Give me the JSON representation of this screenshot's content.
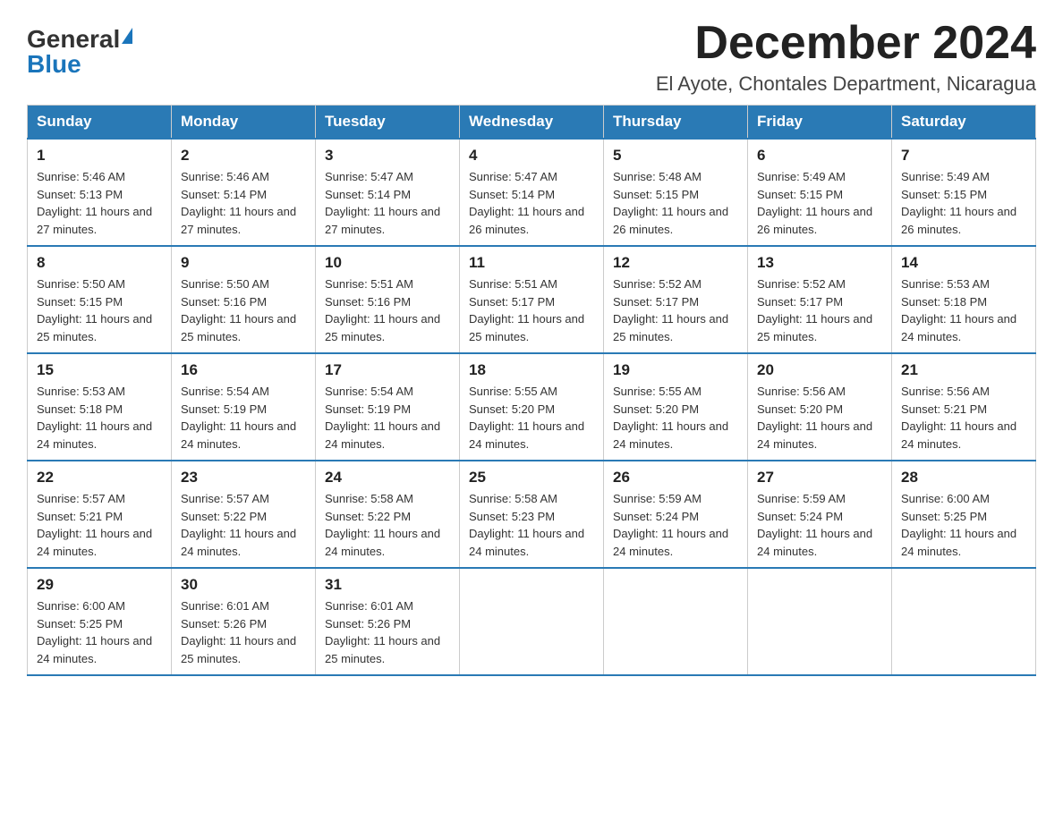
{
  "header": {
    "logo_general": "General",
    "logo_blue": "Blue",
    "month_title": "December 2024",
    "location": "El Ayote, Chontales Department, Nicaragua"
  },
  "weekdays": [
    "Sunday",
    "Monday",
    "Tuesday",
    "Wednesday",
    "Thursday",
    "Friday",
    "Saturday"
  ],
  "weeks": [
    [
      {
        "day": "1",
        "sunrise": "5:46 AM",
        "sunset": "5:13 PM",
        "daylight": "11 hours and 27 minutes."
      },
      {
        "day": "2",
        "sunrise": "5:46 AM",
        "sunset": "5:14 PM",
        "daylight": "11 hours and 27 minutes."
      },
      {
        "day": "3",
        "sunrise": "5:47 AM",
        "sunset": "5:14 PM",
        "daylight": "11 hours and 27 minutes."
      },
      {
        "day": "4",
        "sunrise": "5:47 AM",
        "sunset": "5:14 PM",
        "daylight": "11 hours and 26 minutes."
      },
      {
        "day": "5",
        "sunrise": "5:48 AM",
        "sunset": "5:15 PM",
        "daylight": "11 hours and 26 minutes."
      },
      {
        "day": "6",
        "sunrise": "5:49 AM",
        "sunset": "5:15 PM",
        "daylight": "11 hours and 26 minutes."
      },
      {
        "day": "7",
        "sunrise": "5:49 AM",
        "sunset": "5:15 PM",
        "daylight": "11 hours and 26 minutes."
      }
    ],
    [
      {
        "day": "8",
        "sunrise": "5:50 AM",
        "sunset": "5:15 PM",
        "daylight": "11 hours and 25 minutes."
      },
      {
        "day": "9",
        "sunrise": "5:50 AM",
        "sunset": "5:16 PM",
        "daylight": "11 hours and 25 minutes."
      },
      {
        "day": "10",
        "sunrise": "5:51 AM",
        "sunset": "5:16 PM",
        "daylight": "11 hours and 25 minutes."
      },
      {
        "day": "11",
        "sunrise": "5:51 AM",
        "sunset": "5:17 PM",
        "daylight": "11 hours and 25 minutes."
      },
      {
        "day": "12",
        "sunrise": "5:52 AM",
        "sunset": "5:17 PM",
        "daylight": "11 hours and 25 minutes."
      },
      {
        "day": "13",
        "sunrise": "5:52 AM",
        "sunset": "5:17 PM",
        "daylight": "11 hours and 25 minutes."
      },
      {
        "day": "14",
        "sunrise": "5:53 AM",
        "sunset": "5:18 PM",
        "daylight": "11 hours and 24 minutes."
      }
    ],
    [
      {
        "day": "15",
        "sunrise": "5:53 AM",
        "sunset": "5:18 PM",
        "daylight": "11 hours and 24 minutes."
      },
      {
        "day": "16",
        "sunrise": "5:54 AM",
        "sunset": "5:19 PM",
        "daylight": "11 hours and 24 minutes."
      },
      {
        "day": "17",
        "sunrise": "5:54 AM",
        "sunset": "5:19 PM",
        "daylight": "11 hours and 24 minutes."
      },
      {
        "day": "18",
        "sunrise": "5:55 AM",
        "sunset": "5:20 PM",
        "daylight": "11 hours and 24 minutes."
      },
      {
        "day": "19",
        "sunrise": "5:55 AM",
        "sunset": "5:20 PM",
        "daylight": "11 hours and 24 minutes."
      },
      {
        "day": "20",
        "sunrise": "5:56 AM",
        "sunset": "5:20 PM",
        "daylight": "11 hours and 24 minutes."
      },
      {
        "day": "21",
        "sunrise": "5:56 AM",
        "sunset": "5:21 PM",
        "daylight": "11 hours and 24 minutes."
      }
    ],
    [
      {
        "day": "22",
        "sunrise": "5:57 AM",
        "sunset": "5:21 PM",
        "daylight": "11 hours and 24 minutes."
      },
      {
        "day": "23",
        "sunrise": "5:57 AM",
        "sunset": "5:22 PM",
        "daylight": "11 hours and 24 minutes."
      },
      {
        "day": "24",
        "sunrise": "5:58 AM",
        "sunset": "5:22 PM",
        "daylight": "11 hours and 24 minutes."
      },
      {
        "day": "25",
        "sunrise": "5:58 AM",
        "sunset": "5:23 PM",
        "daylight": "11 hours and 24 minutes."
      },
      {
        "day": "26",
        "sunrise": "5:59 AM",
        "sunset": "5:24 PM",
        "daylight": "11 hours and 24 minutes."
      },
      {
        "day": "27",
        "sunrise": "5:59 AM",
        "sunset": "5:24 PM",
        "daylight": "11 hours and 24 minutes."
      },
      {
        "day": "28",
        "sunrise": "6:00 AM",
        "sunset": "5:25 PM",
        "daylight": "11 hours and 24 minutes."
      }
    ],
    [
      {
        "day": "29",
        "sunrise": "6:00 AM",
        "sunset": "5:25 PM",
        "daylight": "11 hours and 24 minutes."
      },
      {
        "day": "30",
        "sunrise": "6:01 AM",
        "sunset": "5:26 PM",
        "daylight": "11 hours and 25 minutes."
      },
      {
        "day": "31",
        "sunrise": "6:01 AM",
        "sunset": "5:26 PM",
        "daylight": "11 hours and 25 minutes."
      },
      null,
      null,
      null,
      null
    ]
  ]
}
